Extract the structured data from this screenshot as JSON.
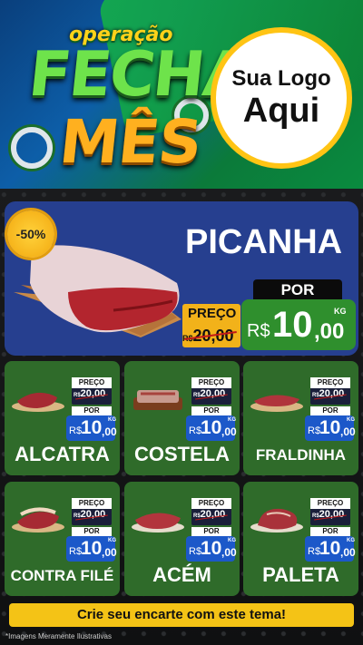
{
  "header": {
    "title_top": "operação",
    "title_mid": "FECHA",
    "title_bottom": "MÊS",
    "logo_line1": "Sua Logo",
    "logo_line2": "Aqui"
  },
  "hero": {
    "discount": "-50%",
    "name": "PICANHA",
    "por_label": "POR",
    "preco_label": "PREÇO",
    "old_currency": "R$",
    "old_price": "20,00",
    "currency": "R$",
    "price_int": "10",
    "price_cents": ",00",
    "unit": "KG"
  },
  "cards": [
    {
      "name": "ALCATRA"
    },
    {
      "name": "COSTELA"
    },
    {
      "name": "FRALDINHA"
    },
    {
      "name": "CONTRA FILÉ"
    },
    {
      "name": "ACÉM"
    },
    {
      "name": "PALETA"
    }
  ],
  "card_common": {
    "preco_label": "PREÇO",
    "old_currency": "R$",
    "old_price": "20,00",
    "por_label": "POR",
    "currency": "R$",
    "price_int": "10",
    "price_cents": ",00",
    "unit": "KG"
  },
  "footer": {
    "cta": "Crie seu encarte com este tema!",
    "note": "*Imagens Meramente Ilustrativas"
  },
  "colors": {
    "card_green": "#2f6b2a",
    "hero_blue": "#263f8f",
    "price_blue": "#1c58c9",
    "yellow": "#f4c316"
  }
}
